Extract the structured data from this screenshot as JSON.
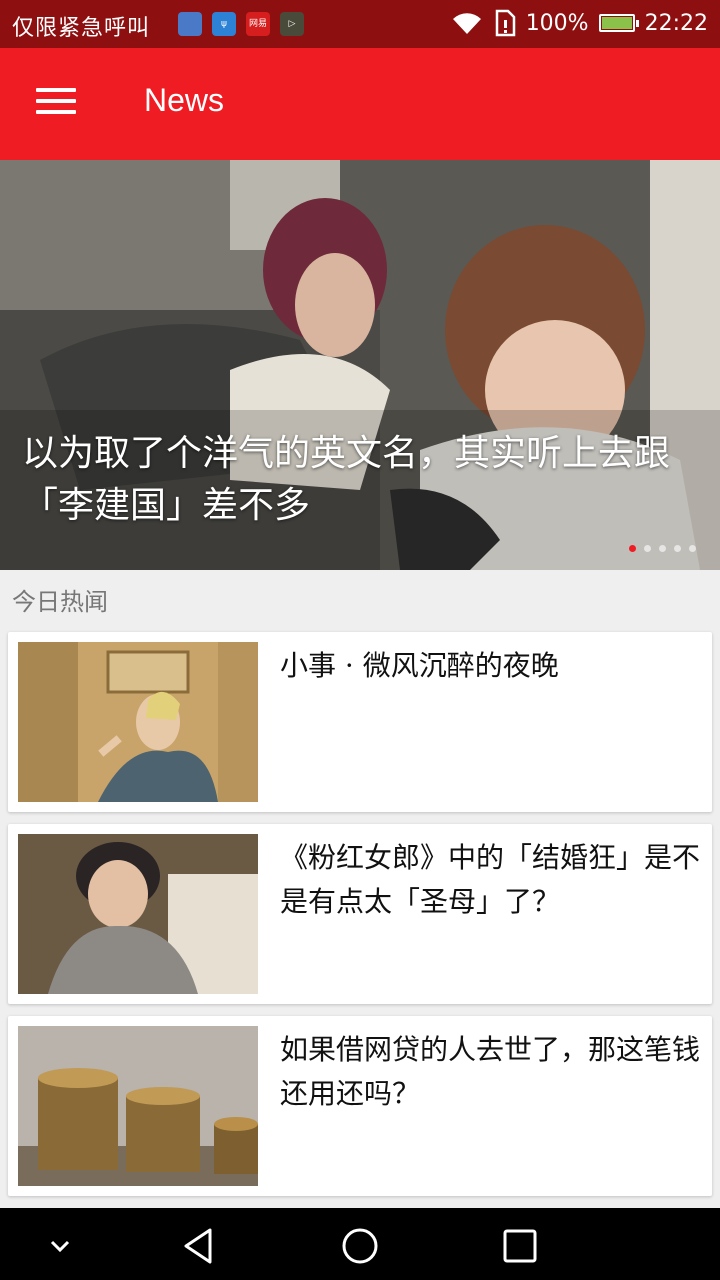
{
  "status_bar": {
    "carrier": "仅限紧急呼叫",
    "app_icons": [
      {
        "name": "health-app-icon",
        "label": "",
        "color": "#4a7ac7"
      },
      {
        "name": "usb-icon",
        "label": "ψ",
        "color": "#2d82d6"
      },
      {
        "name": "netease-news-icon",
        "label": "网易",
        "color": "#d61e1e"
      },
      {
        "name": "video-app-icon",
        "label": "▷",
        "color": "#4a4a3a"
      }
    ],
    "battery": "100%",
    "battery_level": 1.0,
    "time": "22:22"
  },
  "app_bar": {
    "title": "News",
    "background_color": "#ef1c24"
  },
  "banner": {
    "caption": "以为取了个洋气的英文名，其实听上去跟「李建国」差不多",
    "page_count": 5,
    "active_page": 0
  },
  "section": {
    "title": "今日热闻"
  },
  "articles": [
    {
      "title": "小事 · 微风沉醉的夜晚",
      "thumbnail": "woman-on-sofa-photo"
    },
    {
      "title": "《粉红女郎》中的「结婚狂」是不是有点太「圣母」了？",
      "thumbnail": "woman-covering-mouth-photo"
    },
    {
      "title": "如果借网贷的人去世了，那这笔钱还用还吗？",
      "thumbnail": "coin-stacks-photo"
    }
  ],
  "nav_bar": {
    "buttons": [
      "collapse-icon",
      "back-icon",
      "home-icon",
      "recents-icon"
    ]
  }
}
